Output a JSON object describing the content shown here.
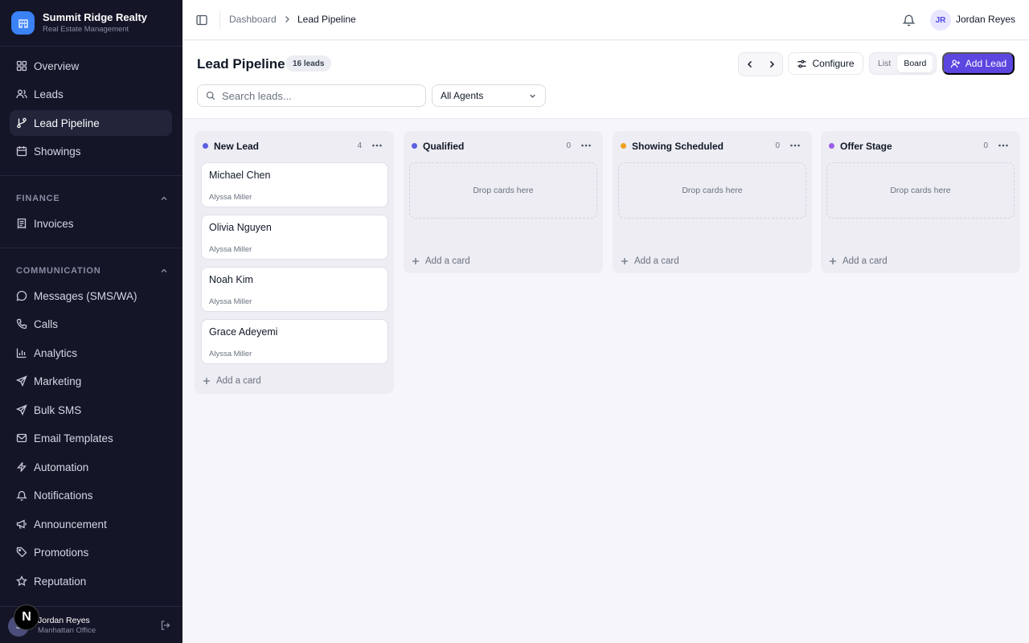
{
  "brand": {
    "name": "Summit Ridge Realty",
    "subtitle": "Real Estate Management"
  },
  "sidebar": {
    "main_items": [
      {
        "label": "Overview",
        "icon": "grid-icon"
      },
      {
        "label": "Leads",
        "icon": "users-icon"
      },
      {
        "label": "Lead Pipeline",
        "icon": "branch-icon",
        "active": true
      },
      {
        "label": "Showings",
        "icon": "calendar-icon"
      }
    ],
    "finance": {
      "title": "FINANCE",
      "items": [
        {
          "label": "Invoices",
          "icon": "receipt-icon"
        }
      ]
    },
    "communication": {
      "title": "COMMUNICATION",
      "items": [
        {
          "label": "Messages (SMS/WA)",
          "icon": "message-icon"
        },
        {
          "label": "Calls",
          "icon": "phone-icon"
        },
        {
          "label": "Analytics",
          "icon": "bar-chart-icon"
        },
        {
          "label": "Marketing",
          "icon": "send-icon"
        },
        {
          "label": "Bulk SMS",
          "icon": "send-icon"
        },
        {
          "label": "Email Templates",
          "icon": "mail-icon"
        },
        {
          "label": "Automation",
          "icon": "zap-icon"
        },
        {
          "label": "Notifications",
          "icon": "bell-icon"
        },
        {
          "label": "Announcement",
          "icon": "megaphone-icon"
        },
        {
          "label": "Promotions",
          "icon": "tag-icon"
        },
        {
          "label": "Reputation",
          "icon": "star-icon"
        }
      ]
    },
    "user": {
      "initial": "S",
      "badge": "N",
      "name": "Jordan Reyes",
      "office": "Manhattan Office"
    }
  },
  "header": {
    "breadcrumb": [
      "Dashboard",
      "Lead Pipeline"
    ],
    "user_initials": "JR",
    "user_name": "Jordan Reyes"
  },
  "page": {
    "title": "Lead Pipeline",
    "count_badge": "16 leads",
    "configure_label": "Configure",
    "view_options": [
      "List",
      "Board"
    ],
    "active_view": "Board",
    "add_label": "Add Lead",
    "search_placeholder": "Search leads...",
    "agent_filter": "All Agents"
  },
  "colors": {
    "accent": "#5b46e0",
    "new_lead": "#5b5fe0",
    "qualified": "#5b5fe0",
    "showing": "#f0a020",
    "offer": "#9b5de5"
  },
  "board": {
    "drop_text": "Drop cards here",
    "add_card_label": "Add a card",
    "columns": [
      {
        "title": "New Lead",
        "count": "4",
        "cards": [
          {
            "name": "Michael Chen",
            "agent": "Alyssa Miller"
          },
          {
            "name": "Olivia Nguyen",
            "agent": "Alyssa Miller"
          },
          {
            "name": "Noah Kim",
            "agent": "Alyssa Miller"
          },
          {
            "name": "Grace Adeyemi",
            "agent": "Alyssa Miller"
          }
        ]
      },
      {
        "title": "Qualified",
        "count": "0",
        "cards": []
      },
      {
        "title": "Showing Scheduled",
        "count": "0",
        "cards": []
      },
      {
        "title": "Offer Stage",
        "count": "0",
        "cards": []
      }
    ]
  }
}
